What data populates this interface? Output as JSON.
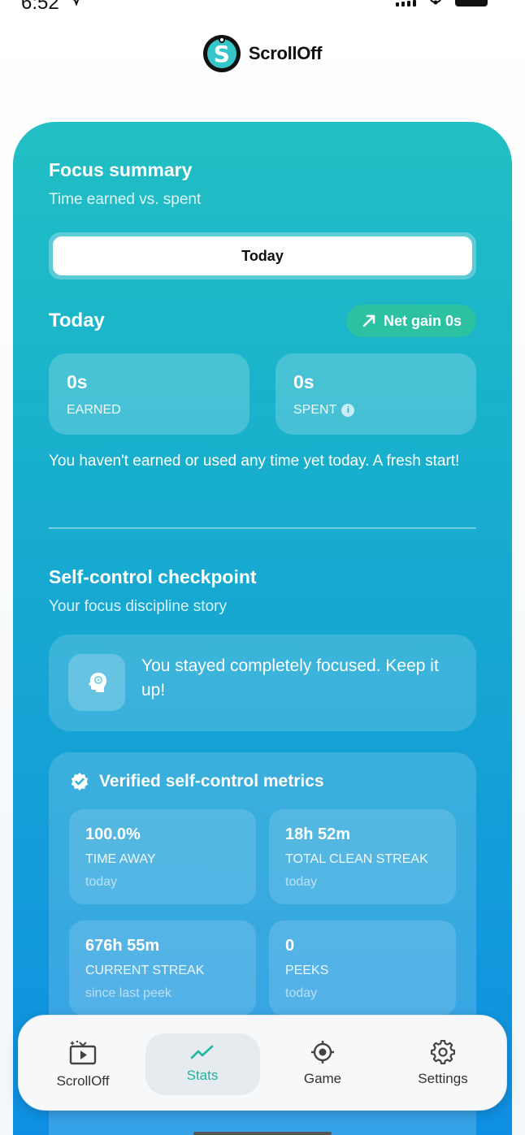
{
  "status_bar": {
    "time": "6:52"
  },
  "header": {
    "app_name": "ScrollOff",
    "logo_letter": "S"
  },
  "focus_summary": {
    "title": "Focus summary",
    "subtitle": "Time earned vs. spent",
    "segment_selected": "Today",
    "period_label": "Today",
    "net_badge": "Net gain 0s",
    "earned": {
      "value": "0s",
      "label": "EARNED"
    },
    "spent": {
      "value": "0s",
      "label": "SPENT"
    },
    "message": "You haven't earned or used any time yet today. A fresh start!"
  },
  "checkpoint": {
    "title": "Self-control checkpoint",
    "subtitle": "Your focus discipline story",
    "message": "You stayed completely focused. Keep it up!"
  },
  "metrics": {
    "title": "Verified self-control metrics",
    "items": [
      {
        "value": "100.0%",
        "label": "TIME AWAY",
        "sub": "today"
      },
      {
        "value": "18h 52m",
        "label": "TOTAL CLEAN STREAK",
        "sub": "today"
      },
      {
        "value": "676h 55m",
        "label": "CURRENT STREAK",
        "sub": "since last peek"
      },
      {
        "value": "0",
        "label": "PEEKS",
        "sub": "today"
      }
    ]
  },
  "nav": {
    "items": [
      {
        "label": "ScrollOff",
        "icon": "tv-sparkle-icon"
      },
      {
        "label": "Stats",
        "icon": "trending-up-icon"
      },
      {
        "label": "Game",
        "icon": "crosshair-icon"
      },
      {
        "label": "Settings",
        "icon": "gear-icon"
      }
    ],
    "active": "Stats"
  },
  "colors": {
    "accent": "#1fb3a2",
    "card_top": "#22bfc4",
    "card_bottom": "#0f8fe3",
    "badge": "#2cc2a1"
  }
}
